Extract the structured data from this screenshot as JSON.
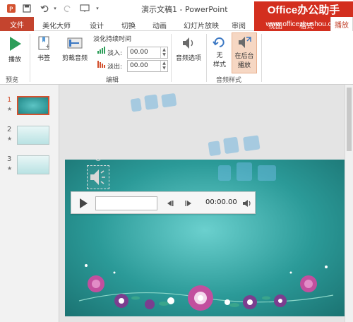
{
  "window": {
    "title": "演示文稿1 - PowerPoint"
  },
  "brand_watermark": {
    "name": "Office办公助手",
    "url": "www.officezhushou.com"
  },
  "tabs": {
    "file": "文件",
    "items": [
      "美化大师",
      "设计",
      "切换",
      "动画",
      "幻灯片放映",
      "审阅",
      "视图",
      "格式"
    ],
    "active": "播放"
  },
  "ribbon": {
    "play_label": "播放",
    "bookmark_label": "书签",
    "trim_audio_label": "剪裁音频",
    "fade_duration_label": "淡化持续时间",
    "fade_in_label": "淡入:",
    "fade_in_value": "00.00",
    "fade_out_label": "淡出:",
    "fade_out_value": "00.00",
    "audio_options_label": "音频选项",
    "no_style_label_1": "无",
    "no_style_label_2": "样式",
    "play_in_background_label_1": "在后台",
    "play_in_background_label_2": "播放",
    "groups": {
      "preview": "预览",
      "edit": "编辑",
      "audio_styles": "音频样式"
    }
  },
  "thumbnails": {
    "items": [
      {
        "number": "1",
        "star": "★"
      },
      {
        "number": "2",
        "star": "★"
      },
      {
        "number": "3",
        "star": "★"
      }
    ]
  },
  "player": {
    "time": "00:00.00"
  },
  "colors": {
    "file_tab": "#c4442e",
    "brand_banner": "#d32f1f",
    "slide_teal": "#2b9a98",
    "selected_button_bg": "#f6d7c3"
  }
}
